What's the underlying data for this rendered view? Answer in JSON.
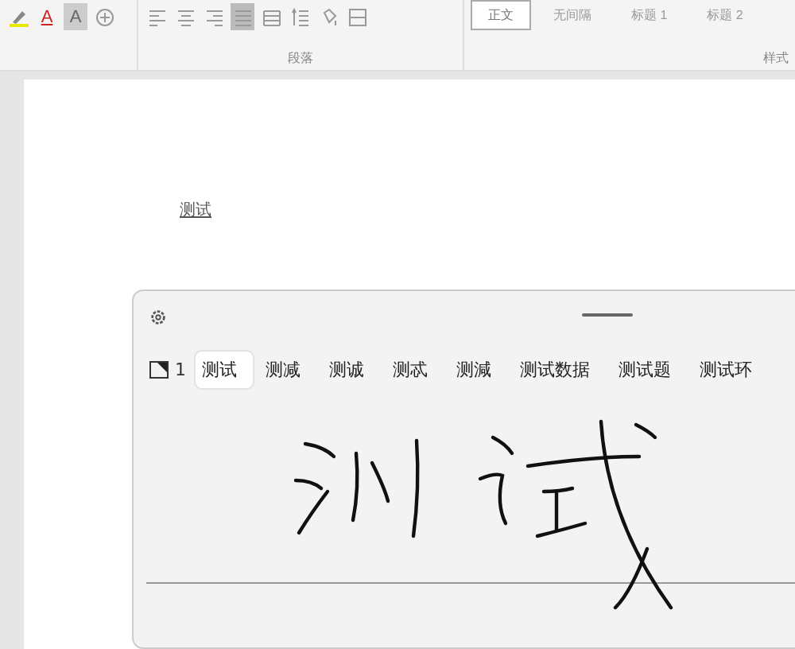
{
  "ribbon": {
    "font_tools": [
      {
        "kind": "highlight"
      },
      {
        "kind": "font-color",
        "label": "A"
      },
      {
        "kind": "shading",
        "label": "A"
      },
      {
        "kind": "enclose"
      }
    ],
    "paragraph_tools": [
      {
        "kind": "align-left",
        "selected": false
      },
      {
        "kind": "align-center",
        "selected": false
      },
      {
        "kind": "align-right",
        "selected": false
      },
      {
        "kind": "justify",
        "selected": true
      },
      {
        "kind": "distribute",
        "selected": false
      },
      {
        "kind": "line-spacing",
        "selected": false
      },
      {
        "kind": "shading",
        "selected": false
      },
      {
        "kind": "borders",
        "selected": false
      }
    ],
    "paragraph_label": "段落",
    "styles": [
      {
        "label": "正文",
        "selected": true
      },
      {
        "label": "无间隔",
        "selected": false
      },
      {
        "label": "标题 1",
        "selected": false
      },
      {
        "label": "标题 2",
        "selected": false
      }
    ],
    "styles_label": "样式"
  },
  "document": {
    "text": "测试"
  },
  "handwriting_panel": {
    "candidate_number": "1",
    "candidates": [
      {
        "text": "测试",
        "selected": true
      },
      {
        "text": "测减",
        "selected": false
      },
      {
        "text": "测诚",
        "selected": false
      },
      {
        "text": "测忒",
        "selected": false
      },
      {
        "text": "测減",
        "selected": false
      },
      {
        "text": "测试数据",
        "selected": false
      },
      {
        "text": "测试题",
        "selected": false
      },
      {
        "text": "测试环",
        "selected": false
      }
    ]
  }
}
